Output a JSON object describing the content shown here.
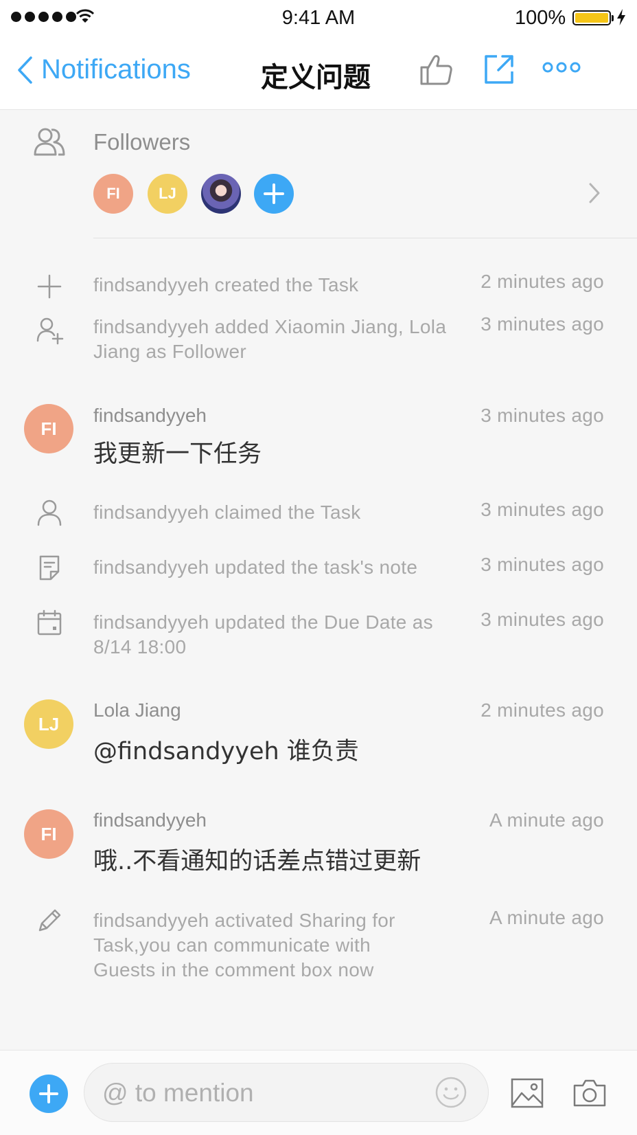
{
  "status_bar": {
    "time": "9:41 AM",
    "battery": "100%"
  },
  "nav": {
    "back_label": "Notifications",
    "title": "定义问题",
    "accent": "#3da8f5"
  },
  "followers": {
    "title": "Followers",
    "avatars": [
      {
        "initials": "FI",
        "color": "#f0a486"
      },
      {
        "initials": "LJ",
        "color": "#f2d062"
      },
      {
        "initials": "",
        "kind": "photo"
      }
    ]
  },
  "activities": [
    {
      "type": "system",
      "icon": "plus-icon",
      "text": "findsandyyeh created the Task",
      "time": "2 minutes ago"
    },
    {
      "type": "system",
      "icon": "add-person-icon",
      "text": "findsandyyeh added Xiaomin Jiang, Lola Jiang as Follower",
      "time": "3 minutes ago"
    },
    {
      "type": "comment",
      "avatar": "FI",
      "author": "findsandyyeh",
      "body": "我更新一下任务",
      "time": "3 minutes ago"
    },
    {
      "type": "system",
      "icon": "person-icon",
      "text": "findsandyyeh claimed the Task",
      "time": "3 minutes ago"
    },
    {
      "type": "system",
      "icon": "note-icon",
      "text": "findsandyyeh updated the task's note",
      "time": "3 minutes ago"
    },
    {
      "type": "system",
      "icon": "calendar-icon",
      "text": "findsandyyeh updated the Due Date as 8/14 18:00",
      "time": "3 minutes ago"
    },
    {
      "type": "comment",
      "avatar": "LJ",
      "author": "Lola Jiang",
      "body": "@findsandyyeh 谁负责",
      "time": "2 minutes ago"
    },
    {
      "type": "comment",
      "avatar": "FI",
      "author": "findsandyyeh",
      "body": "哦..不看通知的话差点错过更新",
      "time": "A minute ago"
    },
    {
      "type": "system",
      "icon": "pencil-icon",
      "text": "findsandyyeh activated Sharing for Task,you can communicate with Guests in the comment box now",
      "time": "A minute ago"
    }
  ],
  "composer": {
    "placeholder": "@ to mention"
  }
}
